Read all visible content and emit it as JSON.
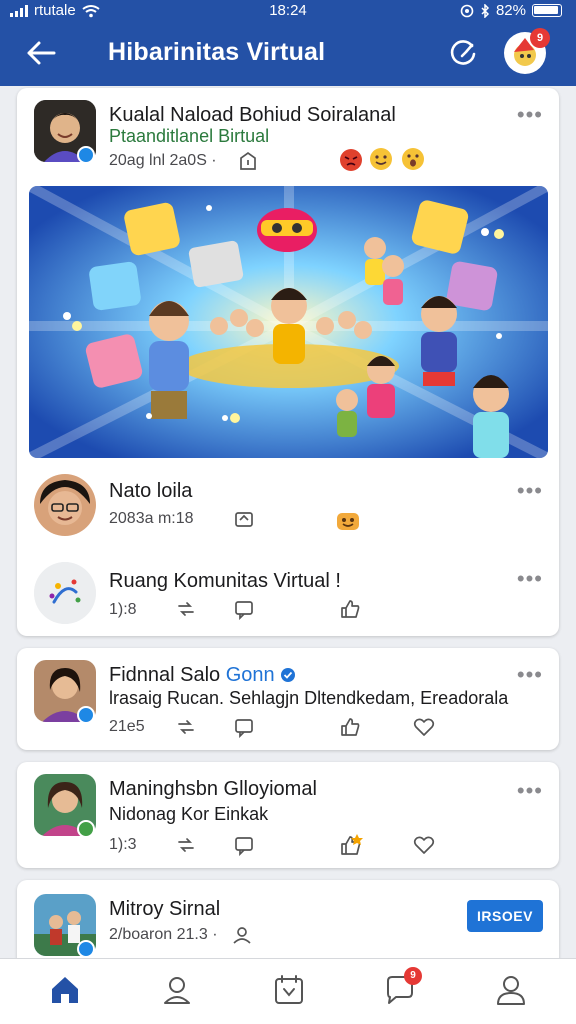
{
  "status_bar": {
    "carrier": "rtutale",
    "time": "18:24",
    "battery": "82%"
  },
  "header": {
    "title": "Hibarinitas Virtual",
    "notification_count": "9"
  },
  "post_main": {
    "author": "Kualal Naload Bohiud Soiralanal",
    "subtitle": "Ptaanditlanel Birtual",
    "meta": "20ag lnl 2a0S ·",
    "reactions": [
      "angry",
      "smile",
      "wow"
    ]
  },
  "post_second": {
    "author": "Nato loila",
    "time": "2083a m:18"
  },
  "post_third": {
    "text": "Ruang Komunitas Virtual !",
    "count": "1):8"
  },
  "post_fourth": {
    "author": "Fidnnal Salo",
    "author_highlight": "Gonn",
    "text": "lrasaig Rucan. Sehlagjn Dltendkedam, Ereadorala",
    "count": "21e5"
  },
  "post_fifth": {
    "author": "Maninghsbn Glloyiomal",
    "subtitle": "Nidonag Kor Einkak",
    "count": "1):3"
  },
  "post_sixth": {
    "author": "Mitroy Sirnal",
    "meta": "2/boaron 21.3 ·",
    "button": "IRSOEV"
  },
  "bottom_nav": {
    "items": [
      "home",
      "community",
      "calendar",
      "messages",
      "profile"
    ],
    "message_badge": "9"
  },
  "colors": {
    "primary": "#2451a6",
    "accent": "#1f73d6",
    "badge": "#e53935"
  }
}
